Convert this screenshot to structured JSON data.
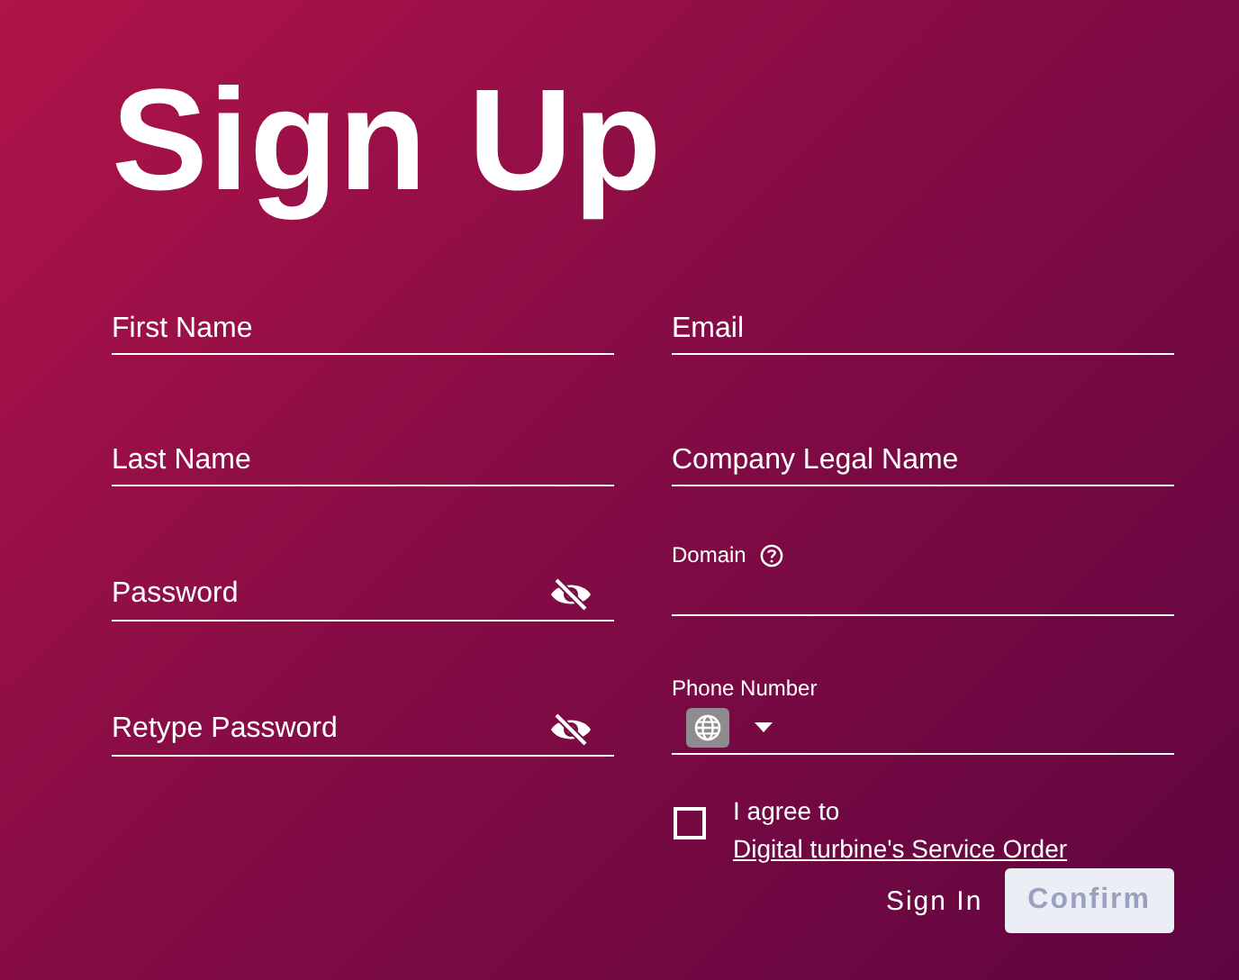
{
  "title": "Sign Up",
  "left_fields": [
    {
      "kind": "text",
      "placeholder": "First Name"
    },
    {
      "kind": "text",
      "placeholder": "Last Name"
    },
    {
      "kind": "password",
      "placeholder": "Password"
    },
    {
      "kind": "password",
      "placeholder": "Retype Password"
    }
  ],
  "right_fields": [
    {
      "kind": "text",
      "placeholder": "Email"
    },
    {
      "kind": "text",
      "placeholder": "Company Legal Name"
    },
    {
      "kind": "help",
      "label": "Domain"
    },
    {
      "kind": "phone",
      "label": "Phone Number"
    }
  ],
  "agreement": {
    "checked": false,
    "text": "I agree to",
    "link": "Digital turbine's Service Order"
  },
  "sign_in": "Sign In",
  "confirm": {
    "label": "Confirm",
    "disabled": true
  }
}
